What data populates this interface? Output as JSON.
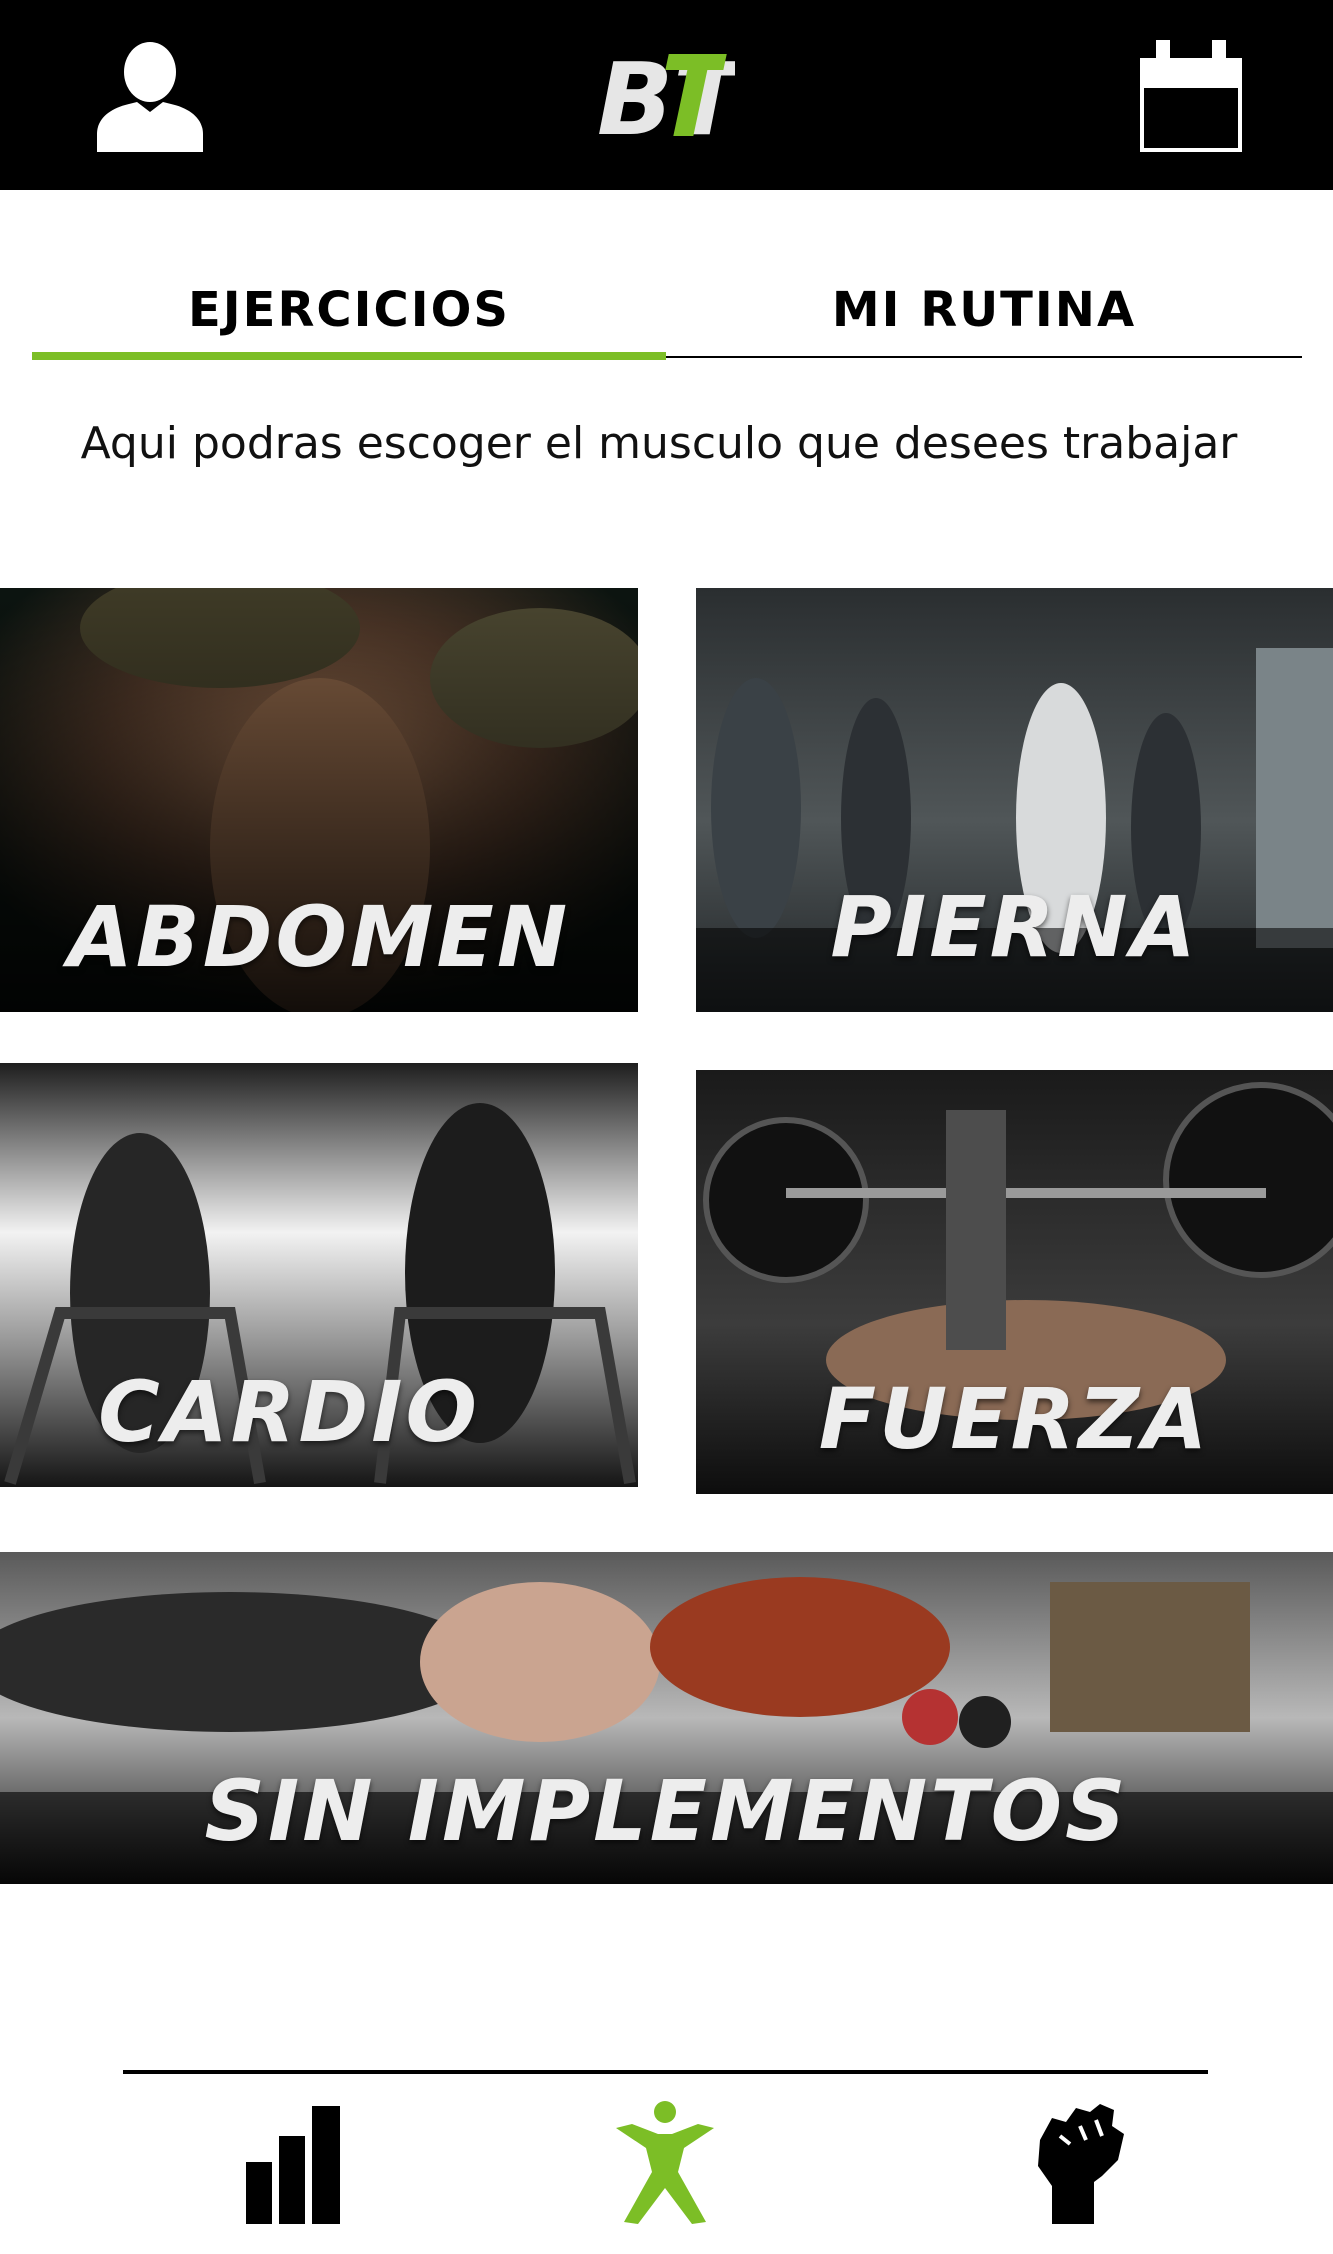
{
  "header": {
    "logo_text": "BT",
    "profile_icon": "user-icon",
    "calendar_icon": "calendar-icon"
  },
  "tabs": [
    {
      "label": "EJERCICIOS",
      "active": true
    },
    {
      "label": "MI RUTINA",
      "active": false
    }
  ],
  "subtitle": "Aqui podras escoger el musculo que desees trabajar",
  "categories": [
    {
      "label": "ABDOMEN"
    },
    {
      "label": "PIERNA"
    },
    {
      "label": "CARDIO"
    },
    {
      "label": "FUERZA"
    },
    {
      "label": "SIN IMPLEMENTOS"
    }
  ],
  "bottom_nav": [
    {
      "icon": "bar-chart-icon",
      "active": false
    },
    {
      "icon": "exercise-figure-icon",
      "active": true
    },
    {
      "icon": "fist-icon",
      "active": false
    }
  ],
  "colors": {
    "accent": "#7cbe26",
    "header_bg": "#000000",
    "background": "#ffffff"
  }
}
